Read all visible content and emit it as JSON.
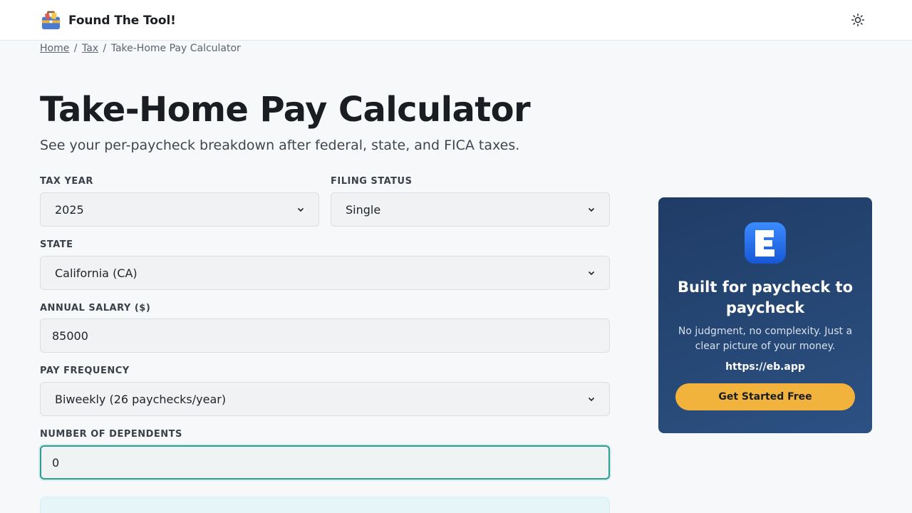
{
  "header": {
    "brand_name": "Found The Tool!",
    "brand_icon": "toolbox-icon",
    "theme_icon": "sun-icon"
  },
  "breadcrumb": {
    "items": [
      "Home",
      "Tax",
      "Take-Home Pay Calculator"
    ],
    "separator": "/"
  },
  "page": {
    "title": "Take-Home Pay Calculator",
    "subtitle": "See your per-paycheck breakdown after federal, state, and FICA taxes."
  },
  "form": {
    "tax_year": {
      "label": "Tax Year",
      "value": "2025"
    },
    "filing_status": {
      "label": "Filing Status",
      "value": "Single"
    },
    "state": {
      "label": "State",
      "value": "California (CA)"
    },
    "annual_salary": {
      "label": "Annual Salary ($)",
      "value": "85000"
    },
    "pay_frequency": {
      "label": "Pay Frequency",
      "value": "Biweekly (26 paychecks/year)"
    },
    "dependents": {
      "label": "Number of Dependents",
      "value": "0"
    }
  },
  "promo": {
    "logo_letter": "E",
    "title": "Built for paycheck to paycheck",
    "text": "No judgment, no complexity. Just a clear picture of your money.",
    "url": "https://eb.app",
    "cta_label": "Get Started Free"
  },
  "colors": {
    "accent": "#2a9d95",
    "promo_bg": "#24456f",
    "cta": "#f2b33d"
  }
}
